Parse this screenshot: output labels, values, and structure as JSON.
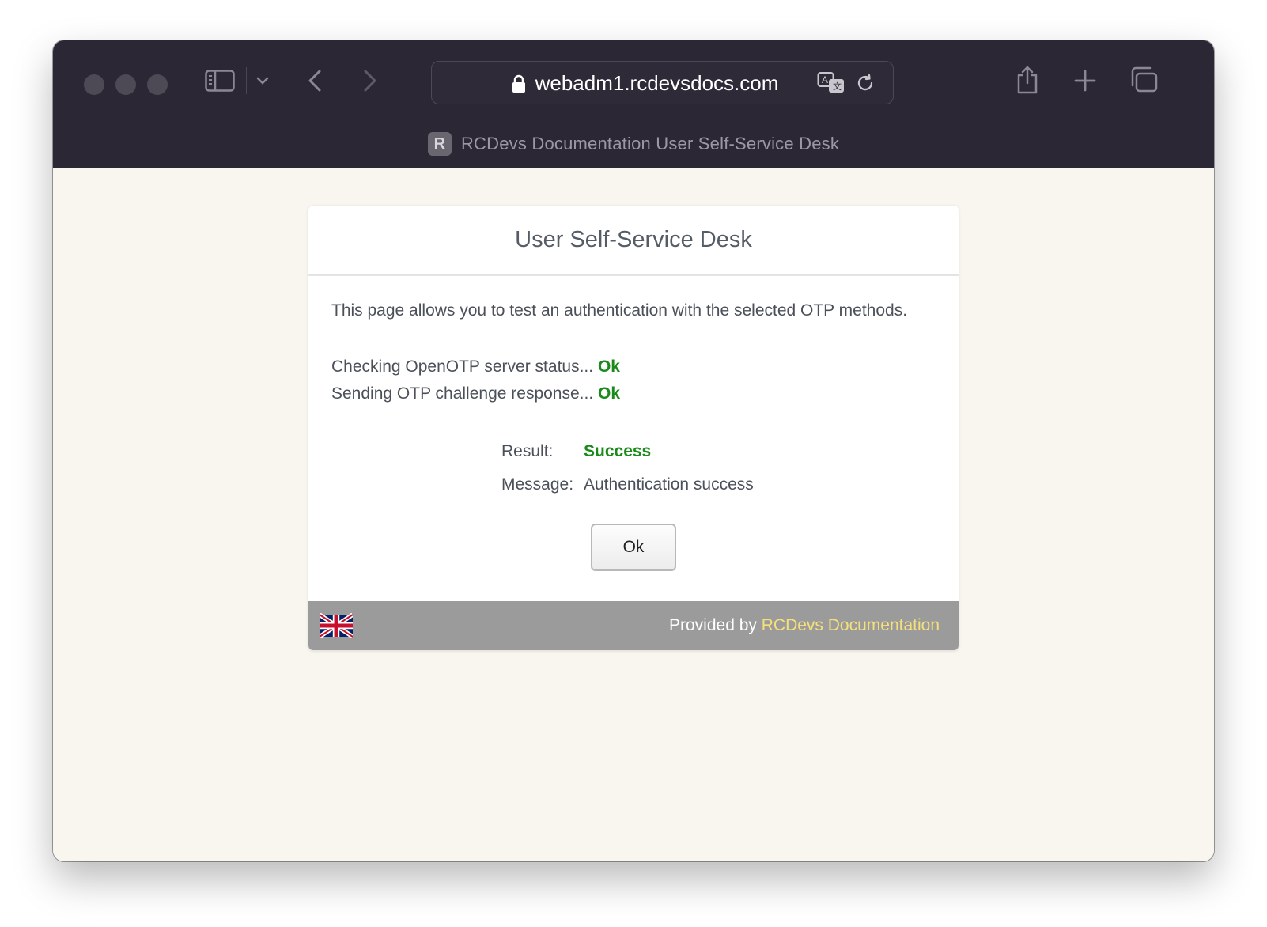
{
  "browser": {
    "url": "webadm1.rcdevsdocs.com",
    "tab_title": "RCDevs Documentation User Self-Service Desk",
    "favicon_letter": "R",
    "icons": [
      "sidebar-icon",
      "chevron-down-icon",
      "back-icon",
      "forward-icon",
      "lock-icon",
      "translate-icon",
      "reload-icon",
      "share-icon",
      "new-tab-icon",
      "tabs-overview-icon"
    ]
  },
  "card": {
    "title": "User Self-Service Desk",
    "intro": "This page allows you to test an authentication with the selected OTP methods.",
    "checks": [
      {
        "text": "Checking OpenOTP server status...",
        "status": "Ok"
      },
      {
        "text": "Sending OTP challenge response...",
        "status": "Ok"
      }
    ],
    "result_label": "Result:",
    "result_value": "Success",
    "message_label": "Message:",
    "message_value": "Authentication success",
    "ok_button": "Ok"
  },
  "footer": {
    "provided_by": "Provided by",
    "provider_link": "RCDevs Documentation",
    "language_flag": "uk-flag-icon"
  },
  "colors": {
    "titlebar": "#2c2734",
    "page_background": "#f9f5ef",
    "status_ok": "#1a8a1a",
    "footer": "#9b9b9b",
    "link": "#f6e07a"
  }
}
